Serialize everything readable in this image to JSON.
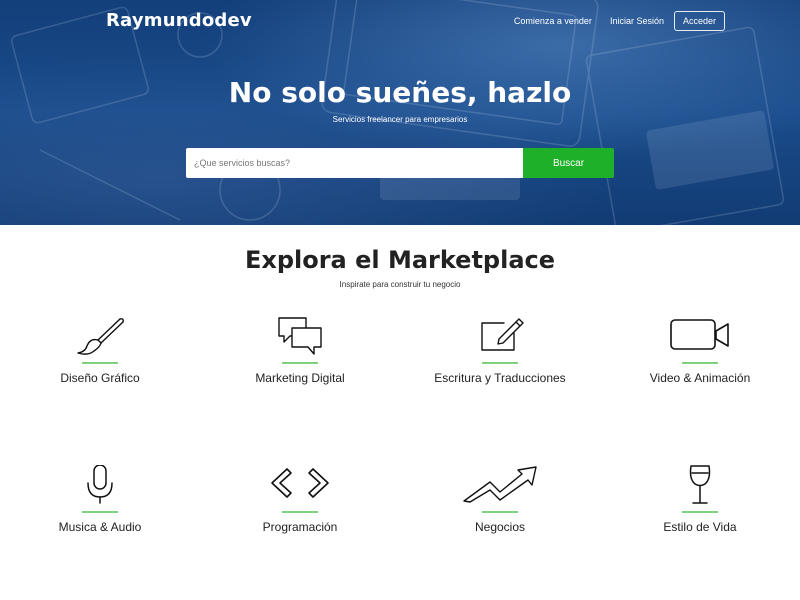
{
  "header": {
    "brand": "Raymundodev",
    "nav": [
      {
        "label": "Comienza a vender"
      },
      {
        "label": "Iniciar Sesión"
      }
    ],
    "login_button": "Acceder"
  },
  "hero": {
    "title": "No solo sueñes, hazlo",
    "subtitle": "Servicios freelancer para empresarios",
    "search": {
      "placeholder": "¿Que servicios buscas?",
      "value": "",
      "button": "Buscar"
    }
  },
  "colors": {
    "hero_bg": "#1a4c8c",
    "accent_green": "#1fb02a",
    "underline_green": "#7ed07b"
  },
  "marketplace": {
    "title": "Explora el Marketplace",
    "subtitle": "Inspirate para construir tu negocio",
    "categories": [
      {
        "label": "Diseño Gráfico",
        "icon": "brush-icon"
      },
      {
        "label": "Marketing Digital",
        "icon": "chat-bubbles-icon"
      },
      {
        "label": "Escritura y Traducciones",
        "icon": "edit-icon"
      },
      {
        "label": "Video & Animación",
        "icon": "video-camera-icon"
      },
      {
        "label": "Musica & Audio",
        "icon": "microphone-icon"
      },
      {
        "label": "Programación",
        "icon": "code-icon"
      },
      {
        "label": "Negocios",
        "icon": "trend-up-icon"
      },
      {
        "label": "Estilo de Vida",
        "icon": "wine-glass-icon"
      }
    ]
  }
}
